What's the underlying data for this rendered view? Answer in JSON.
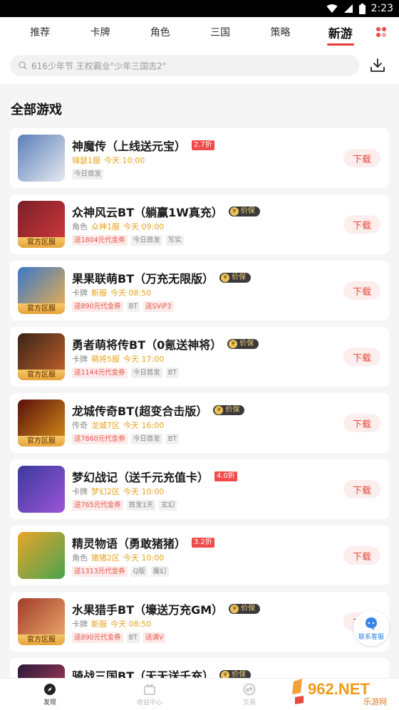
{
  "status": {
    "time": "2:23"
  },
  "nav": {
    "tabs": [
      {
        "label": "推荐"
      },
      {
        "label": "卡牌"
      },
      {
        "label": "角色"
      },
      {
        "label": "三国"
      },
      {
        "label": "策略"
      },
      {
        "label": "新游",
        "active": true
      }
    ]
  },
  "search": {
    "placeholder": "616少年节 王权霸业\"少年三国志2\""
  },
  "section_title": "全部游戏",
  "download_label": "下载",
  "official_badge": "官方区服",
  "price_label": "价保",
  "games": [
    {
      "title": "神魔传（上线送元宝）",
      "discount": "2.7折",
      "category": "",
      "server": "锦瑟1服",
      "time": "今天 10:00",
      "tags": [
        {
          "t": "今日首发",
          "red": false
        }
      ],
      "official": false,
      "color": "#5b7fb8",
      "color2": "#e6e9f0"
    },
    {
      "title": "众神风云BT（躺赢1W真充）",
      "price_tag": true,
      "category": "角色",
      "server": "众神1服",
      "time": "今天 09:00",
      "tags": [
        {
          "t": "送1804元代金券",
          "red": true
        },
        {
          "t": "今日首发",
          "red": false
        },
        {
          "t": "写实",
          "red": false
        }
      ],
      "official": true,
      "color": "#7a1f2a",
      "color2": "#d23a3a"
    },
    {
      "title": "果果联萌BT（万充无限版）",
      "price_tag": true,
      "category": "卡牌",
      "server": "新服",
      "time": "今天 08:50",
      "tags": [
        {
          "t": "送890元代金券",
          "red": true
        },
        {
          "t": "BT",
          "red": false
        },
        {
          "t": "送SVIP3",
          "red": true
        }
      ],
      "official": true,
      "color": "#3a77c9",
      "color2": "#f2b24a"
    },
    {
      "title": "勇者萌将传BT（0氪送神将）",
      "price_tag": true,
      "category": "卡牌",
      "server": "萌将5服",
      "time": "今天 17:00",
      "tags": [
        {
          "t": "送1144元代金券",
          "red": true
        },
        {
          "t": "今日首发",
          "red": false
        },
        {
          "t": "BT",
          "red": false
        }
      ],
      "official": true,
      "color": "#3a2418",
      "color2": "#c8632a"
    },
    {
      "title": "龙城传奇BT(超变合击版）",
      "price_tag": true,
      "category": "传奇",
      "server": "龙城7区",
      "time": "今天 16:00",
      "tags": [
        {
          "t": "送7860元代金券",
          "red": true
        },
        {
          "t": "今日首发",
          "red": false
        },
        {
          "t": "BT",
          "red": false
        }
      ],
      "official": true,
      "color": "#5a0f0a",
      "color2": "#d8921a"
    },
    {
      "title": "梦幻战记（送千元充值卡）",
      "discount": "4.0折",
      "category": "卡牌",
      "server": "梦幻2区",
      "time": "今天 10:00",
      "tags": [
        {
          "t": "送765元代金券",
          "red": true
        },
        {
          "t": "首发1天",
          "red": false
        },
        {
          "t": "玄幻",
          "red": false
        }
      ],
      "official": false,
      "color": "#3b3a9c",
      "color2": "#9b55d8"
    },
    {
      "title": "精灵物语（勇敢猪猪）",
      "discount": "3.2折",
      "category": "角色",
      "server": "猪猪2区",
      "time": "今天 10:00",
      "tags": [
        {
          "t": "送1313元代金券",
          "red": true
        },
        {
          "t": "Q版",
          "red": false
        },
        {
          "t": "魔幻",
          "red": false
        }
      ],
      "official": false,
      "color": "#e9a52b",
      "color2": "#4aa34e"
    },
    {
      "title": "水果猎手BT（壕送万充GM）",
      "price_tag": true,
      "category": "卡牌",
      "server": "新服",
      "time": "今天 08:50",
      "tags": [
        {
          "t": "送890元代金券",
          "red": true
        },
        {
          "t": "BT",
          "red": false
        },
        {
          "t": "送满V",
          "red": true
        }
      ],
      "official": true,
      "color": "#a23a2a",
      "color2": "#f0b070"
    },
    {
      "title": "骑战三国BT（天天送千充）",
      "price_tag": true,
      "category": "",
      "server": "",
      "time": "",
      "tags": [],
      "official": true,
      "color": "#2a1a3a",
      "color2": "#c04060"
    }
  ],
  "float_service": {
    "label": "联系客服"
  },
  "bottom_tabs": [
    {
      "label": "发现",
      "active": true
    },
    {
      "label": "收益中心",
      "active": false
    },
    {
      "label": "交易",
      "active": false
    }
  ],
  "watermark": {
    "brand": "962.NET",
    "sub": "乐游网"
  },
  "colors": {
    "accent": "#e8473a",
    "gold": "#e8a31d"
  }
}
